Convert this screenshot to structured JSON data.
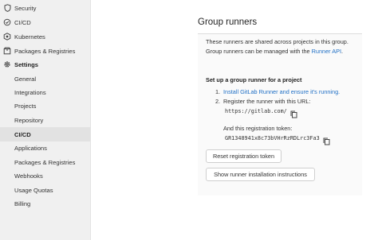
{
  "sidebar": {
    "items": [
      {
        "label": "Security",
        "icon": "shield-icon"
      },
      {
        "label": "CI/CD",
        "icon": "rocket-icon"
      },
      {
        "label": "Kubernetes",
        "icon": "kubernetes-icon"
      },
      {
        "label": "Packages & Registries",
        "icon": "package-icon"
      },
      {
        "label": "Settings",
        "icon": "gear-icon"
      }
    ],
    "sub_items": [
      {
        "label": "General"
      },
      {
        "label": "Integrations"
      },
      {
        "label": "Projects"
      },
      {
        "label": "Repository"
      },
      {
        "label": "CI/CD"
      },
      {
        "label": "Applications"
      },
      {
        "label": "Packages & Registries"
      },
      {
        "label": "Webhooks"
      },
      {
        "label": "Usage Quotas"
      },
      {
        "label": "Billing"
      }
    ]
  },
  "main": {
    "title": "Group runners",
    "desc_line1": "These runners are shared across projects in this group.",
    "desc_line2_prefix": "Group runners can be managed with the ",
    "desc_line2_link": "Runner API",
    "desc_line2_suffix": ".",
    "setup_heading": "Set up a group runner for a project",
    "step1_num": "1.",
    "step1_link": "Install GitLab Runner and ensure it's running.",
    "step2_num": "2.",
    "step2_text": "Register the runner with this URL:",
    "url": "https://gitlab.com/",
    "token_label": "And this registration token:",
    "token": "GR1348941x8c73bVHrRzRDLrc3Fa3",
    "reset_button": "Reset registration token",
    "install_button": "Show runner installation instructions"
  },
  "colors": {
    "link": "#1f6fc5",
    "sidebar_bg": "#f0f0f0",
    "active_bg": "#e2e2e2"
  }
}
